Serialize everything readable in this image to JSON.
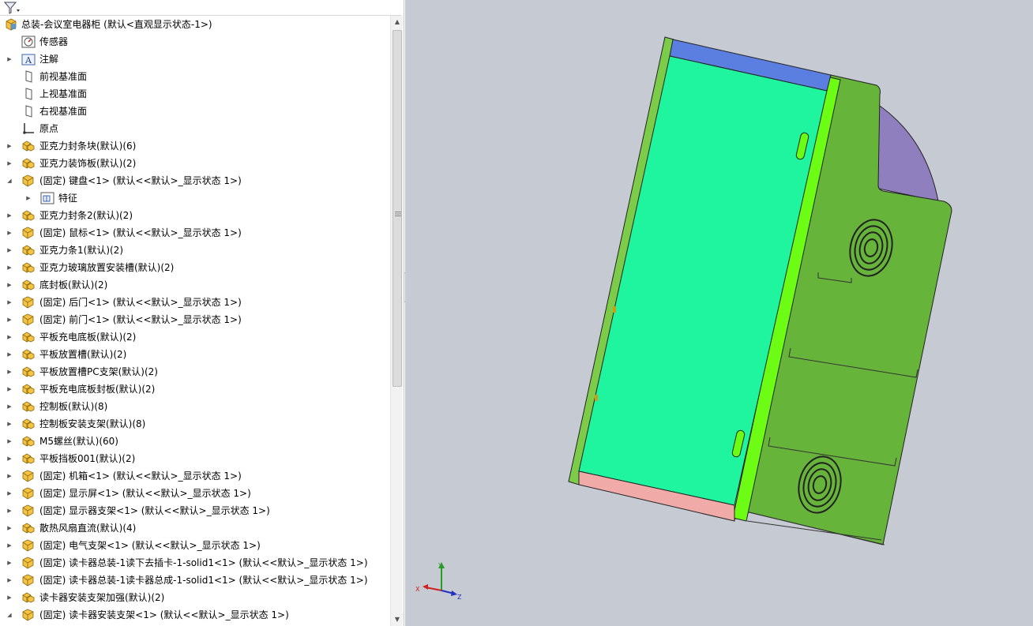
{
  "tree": {
    "root": {
      "label": "总装-会议室电器柜  (默认<直观显示状态-1>)",
      "icon": "assembly-icon"
    },
    "items": [
      {
        "label": "传感器",
        "icon": "sensor-icon",
        "arrow": "none",
        "level": 1
      },
      {
        "label": "注解",
        "icon": "annotation-icon",
        "arrow": "collapsed",
        "level": 1
      },
      {
        "label": "前视基准面",
        "icon": "plane-icon",
        "arrow": "none",
        "level": 1
      },
      {
        "label": "上视基准面",
        "icon": "plane-icon",
        "arrow": "none",
        "level": 1
      },
      {
        "label": "右视基准面",
        "icon": "plane-icon",
        "arrow": "none",
        "level": 1
      },
      {
        "label": "原点",
        "icon": "origin-icon",
        "arrow": "none",
        "level": 1
      },
      {
        "label": "亚克力封条块(默认)(6)",
        "icon": "subassembly-icon",
        "arrow": "collapsed",
        "level": 1
      },
      {
        "label": "亚克力装饰板(默认)(2)",
        "icon": "subassembly-icon",
        "arrow": "collapsed",
        "level": 1
      },
      {
        "label": "(固定) 键盘<1> (默认<<默认>_显示状态 1>)",
        "icon": "part-icon",
        "arrow": "expanded",
        "level": 1
      },
      {
        "label": "特征",
        "icon": "features-folder-icon",
        "arrow": "collapsed",
        "level": 2
      },
      {
        "label": "亚克力封条2(默认)(2)",
        "icon": "subassembly-icon",
        "arrow": "collapsed",
        "level": 1
      },
      {
        "label": "(固定) 鼠标<1> (默认<<默认>_显示状态 1>)",
        "icon": "part-icon",
        "arrow": "collapsed",
        "level": 1
      },
      {
        "label": "亚克力条1(默认)(2)",
        "icon": "subassembly-icon",
        "arrow": "collapsed",
        "level": 1
      },
      {
        "label": "亚克力玻璃放置安装槽(默认)(2)",
        "icon": "subassembly-icon",
        "arrow": "collapsed",
        "level": 1
      },
      {
        "label": "底封板(默认)(2)",
        "icon": "subassembly-icon",
        "arrow": "collapsed",
        "level": 1
      },
      {
        "label": "(固定) 后门<1> (默认<<默认>_显示状态 1>)",
        "icon": "part-icon",
        "arrow": "collapsed",
        "level": 1
      },
      {
        "label": "(固定) 前门<1> (默认<<默认>_显示状态 1>)",
        "icon": "part-icon",
        "arrow": "collapsed",
        "level": 1
      },
      {
        "label": "平板充电底板(默认)(2)",
        "icon": "subassembly-icon",
        "arrow": "collapsed",
        "level": 1
      },
      {
        "label": "平板放置槽(默认)(2)",
        "icon": "subassembly-icon",
        "arrow": "collapsed",
        "level": 1
      },
      {
        "label": "平板放置槽PC支架(默认)(2)",
        "icon": "subassembly-icon",
        "arrow": "collapsed",
        "level": 1
      },
      {
        "label": "平板充电底板封板(默认)(2)",
        "icon": "subassembly-icon",
        "arrow": "collapsed",
        "level": 1
      },
      {
        "label": "控制板(默认)(8)",
        "icon": "subassembly-icon",
        "arrow": "collapsed",
        "level": 1
      },
      {
        "label": "控制板安装支架(默认)(8)",
        "icon": "subassembly-icon",
        "arrow": "collapsed",
        "level": 1
      },
      {
        "label": "M5螺丝(默认)(60)",
        "icon": "subassembly-icon",
        "arrow": "collapsed",
        "level": 1
      },
      {
        "label": "平板挡板001(默认)(2)",
        "icon": "subassembly-icon",
        "arrow": "collapsed",
        "level": 1
      },
      {
        "label": "(固定) 机箱<1> (默认<<默认>_显示状态 1>)",
        "icon": "part-icon",
        "arrow": "collapsed",
        "level": 1
      },
      {
        "label": "(固定) 显示屏<1> (默认<<默认>_显示状态 1>)",
        "icon": "part-icon",
        "arrow": "collapsed",
        "level": 1
      },
      {
        "label": "(固定) 显示器支架<1> (默认<<默认>_显示状态 1>)",
        "icon": "part-icon",
        "arrow": "collapsed",
        "level": 1
      },
      {
        "label": "散热风扇直流(默认)(4)",
        "icon": "subassembly-icon",
        "arrow": "collapsed",
        "level": 1
      },
      {
        "label": "(固定) 电气支架<1> (默认<<默认>_显示状态 1>)",
        "icon": "part-icon",
        "arrow": "collapsed",
        "level": 1
      },
      {
        "label": "(固定) 读卡器总装-1读下去插卡-1-solid1<1> (默认<<默认>_显示状态 1>)",
        "icon": "part-icon",
        "arrow": "collapsed",
        "level": 1
      },
      {
        "label": "(固定) 读卡器总装-1读卡器总成-1-solid1<1> (默认<<默认>_显示状态 1>)",
        "icon": "part-icon",
        "arrow": "collapsed",
        "level": 1
      },
      {
        "label": "读卡器安装支架加强(默认)(2)",
        "icon": "subassembly-icon",
        "arrow": "collapsed",
        "level": 1
      },
      {
        "label": "(固定) 读卡器安装支架<1> (默认<<默认>_显示状态 1>)",
        "icon": "part-icon",
        "arrow": "expanded",
        "level": 1
      }
    ]
  },
  "triad": {
    "x_label": "X",
    "y_label": "Y",
    "z_label": "Z"
  },
  "colors": {
    "cabinet_green": "#66b43a",
    "front_cyan": "#1ef59e",
    "edge_lime": "#6dfc14",
    "blue_strip": "#5b7fe0",
    "pink_strip": "#f0aaa8",
    "purple_arc": "#8f7fbf",
    "viewport_bg": "#c6cad2",
    "icon_yellow": "#f5c242"
  }
}
